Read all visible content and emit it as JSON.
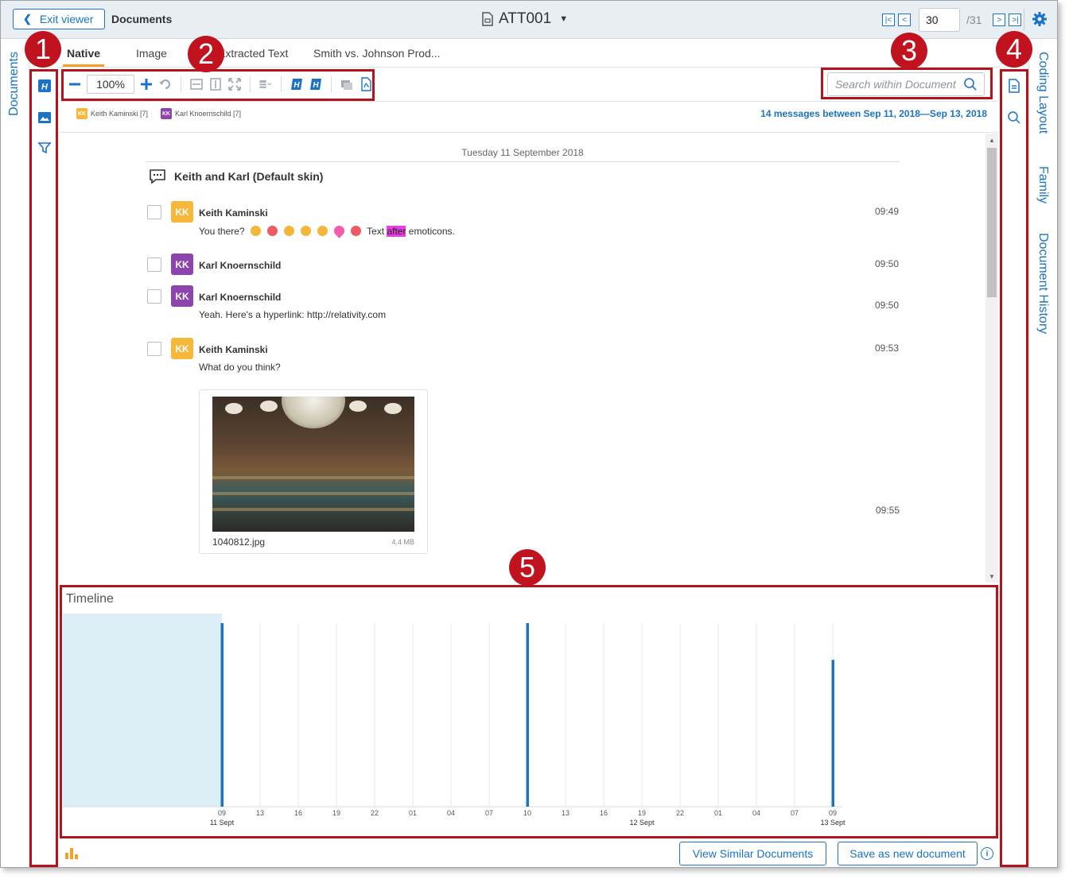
{
  "header": {
    "exit_label": "Exit viewer",
    "section_title": "Documents",
    "document_name": "ATT001",
    "current_page": "30",
    "total_pages": "/31"
  },
  "left_rail": {
    "label": "Documents"
  },
  "tabs": [
    {
      "label": "Native"
    },
    {
      "label": "Image"
    },
    {
      "label": "Extracted Text"
    },
    {
      "label": "Smith vs. Johnson Prod..."
    }
  ],
  "toolbar": {
    "zoom": "100%"
  },
  "search": {
    "placeholder": "Search within Document"
  },
  "participants": [
    {
      "initials": "KK",
      "label": "Keith Kaminski [7]",
      "color": "#f7b83a"
    },
    {
      "initials": "KK",
      "label": "Karl Knoernschild [7]",
      "color": "#8e44ad"
    }
  ],
  "message_range": "14 messages between Sep 11, 2018—Sep 13, 2018",
  "conversation": {
    "day": "Tuesday 11 September 2018",
    "title": "Keith and Karl (Default skin)",
    "messages": [
      {
        "initials": "KK",
        "sender": "Keith Kaminski",
        "time": "09:49",
        "text_before": "You there?",
        "text_highlight": "after",
        "text_after_pre": "Text",
        "text_after": "emoticons.",
        "color": "#f7b83a"
      },
      {
        "initials": "KK",
        "sender": "Karl Knoernschild",
        "time": "09:50",
        "text": "",
        "color": "#8e44ad"
      },
      {
        "initials": "KK",
        "sender": "Karl Knoernschild",
        "time": "09:50",
        "text": "Yeah. Here's a hyperlink: http://relativity.com",
        "color": "#8e44ad"
      },
      {
        "initials": "KK",
        "sender": "Keith Kaminski",
        "time": "09:53",
        "text": "What do you think?",
        "color": "#f7b83a"
      }
    ],
    "attachment": {
      "name": "1040812.jpg",
      "size": "4.4 MB",
      "time": "09:55"
    }
  },
  "timeline": {
    "title": "Timeline",
    "tick_labels": [
      "09",
      "13",
      "16",
      "19",
      "22",
      "01",
      "04",
      "07",
      "10",
      "13",
      "16",
      "19",
      "22",
      "01",
      "04",
      "07",
      "09"
    ],
    "date_labels": [
      {
        "tick_index": 0,
        "label": "11 Sept"
      },
      {
        "tick_index": 11,
        "label": "12 Sept"
      },
      {
        "tick_index": 16,
        "label": "13 Sept"
      }
    ],
    "bars": [
      {
        "tick_index": 0,
        "level": 1.0
      },
      {
        "tick_index": 8,
        "level": 1.0
      },
      {
        "tick_index": 16,
        "level": 0.8
      }
    ],
    "selection_end_tick": 0,
    "accent": "#1a73c7",
    "selection_color": "#dceff7"
  },
  "actions": {
    "similar_label": "View Similar Documents",
    "save_label": "Save as new document"
  },
  "right_rail": {
    "labels": [
      "Coding Layout",
      "Family",
      "Document History"
    ]
  },
  "markers": [
    "1",
    "2",
    "3",
    "4",
    "5"
  ],
  "colors": {
    "accent": "#1a73c7",
    "annotation_red": "#b3141c",
    "tab_active": "#f0a02b"
  }
}
